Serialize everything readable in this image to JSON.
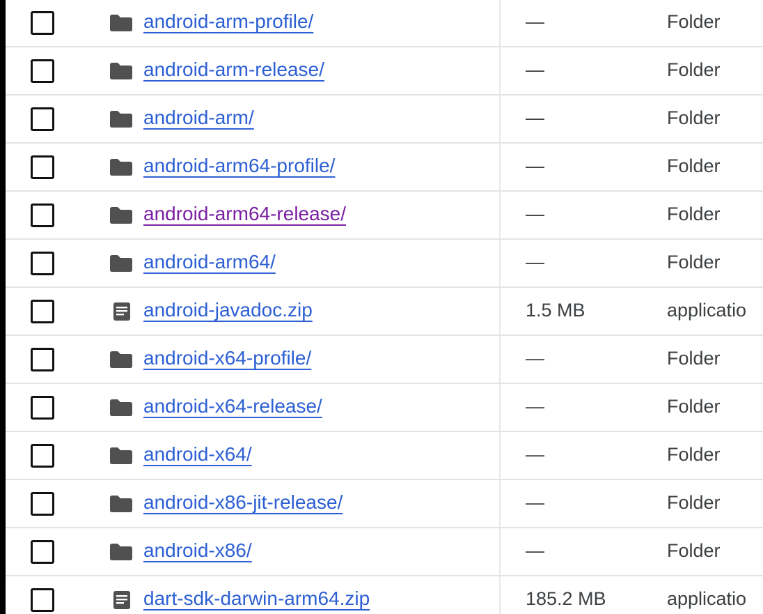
{
  "files": [
    {
      "name": "android-arm-profile/",
      "size": "—",
      "type": "Folder",
      "icon": "folder-icon",
      "visited": false
    },
    {
      "name": "android-arm-release/",
      "size": "—",
      "type": "Folder",
      "icon": "folder-icon",
      "visited": false
    },
    {
      "name": "android-arm/",
      "size": "—",
      "type": "Folder",
      "icon": "folder-icon",
      "visited": false
    },
    {
      "name": "android-arm64-profile/",
      "size": "—",
      "type": "Folder",
      "icon": "folder-icon",
      "visited": false
    },
    {
      "name": "android-arm64-release/",
      "size": "—",
      "type": "Folder",
      "icon": "folder-icon",
      "visited": true
    },
    {
      "name": "android-arm64/",
      "size": "—",
      "type": "Folder",
      "icon": "folder-icon",
      "visited": false
    },
    {
      "name": "android-javadoc.zip",
      "size": "1.5 MB",
      "type": "applicatio",
      "icon": "file-icon",
      "visited": false
    },
    {
      "name": "android-x64-profile/",
      "size": "—",
      "type": "Folder",
      "icon": "folder-icon",
      "visited": false
    },
    {
      "name": "android-x64-release/",
      "size": "—",
      "type": "Folder",
      "icon": "folder-icon",
      "visited": false
    },
    {
      "name": "android-x64/",
      "size": "—",
      "type": "Folder",
      "icon": "folder-icon",
      "visited": false
    },
    {
      "name": "android-x86-jit-release/",
      "size": "—",
      "type": "Folder",
      "icon": "folder-icon",
      "visited": false
    },
    {
      "name": "android-x86/",
      "size": "—",
      "type": "Folder",
      "icon": "folder-icon",
      "visited": false
    },
    {
      "name": "dart-sdk-darwin-arm64.zip",
      "size": "185.2 MB",
      "type": "applicatio",
      "icon": "file-icon",
      "visited": false
    }
  ],
  "colors": {
    "link": "#2c5fd4",
    "visited_link": "#7b1fa2",
    "text": "#3c4043",
    "icon": "#505050",
    "row_divider": "#e3e3e3"
  }
}
